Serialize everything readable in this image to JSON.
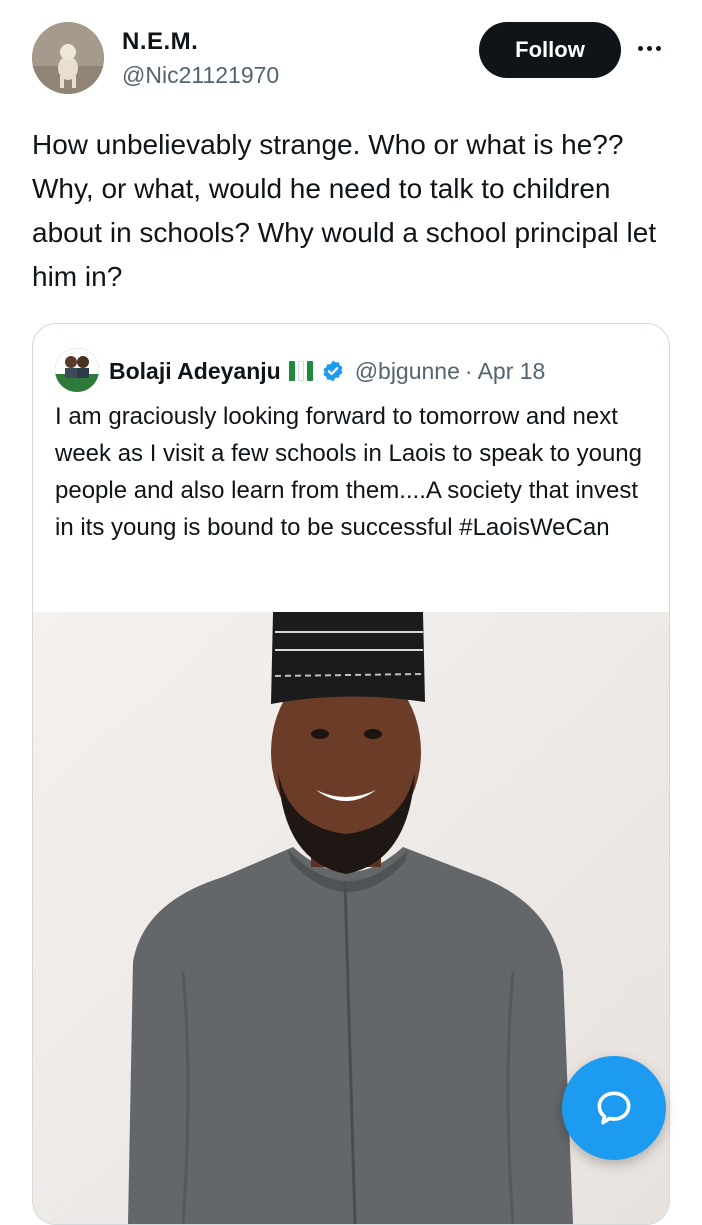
{
  "author": {
    "display_name": "N.E.M.",
    "handle": "@Nic21121970"
  },
  "actions": {
    "follow_label": "Follow",
    "more_icon": "more-horizontal-icon"
  },
  "tweet": {
    "text": "How unbelievably strange. Who or what is he?? Why, or what, would he need to talk to children about in schools? Why would a school principal let him in?"
  },
  "quoted": {
    "display_name": "Bolaji Adeyanju",
    "flag_icon": "nigeria-flag-icon",
    "verified_icon": "verified-badge-icon",
    "handle": "@bjgunne",
    "separator": "·",
    "date": "Apr 18",
    "text": "I am graciously looking forward to tomorrow and next week as I visit a few schools in Laois to speak to young people and also learn from them....A society that invest in its young is bound to be successful #LaoisWeCan"
  },
  "fab": {
    "icon": "compose-message-icon"
  },
  "colors": {
    "accent": "#1d9bf0",
    "text": "#0f1419",
    "secondary": "#536471",
    "border": "#cfd9de"
  }
}
